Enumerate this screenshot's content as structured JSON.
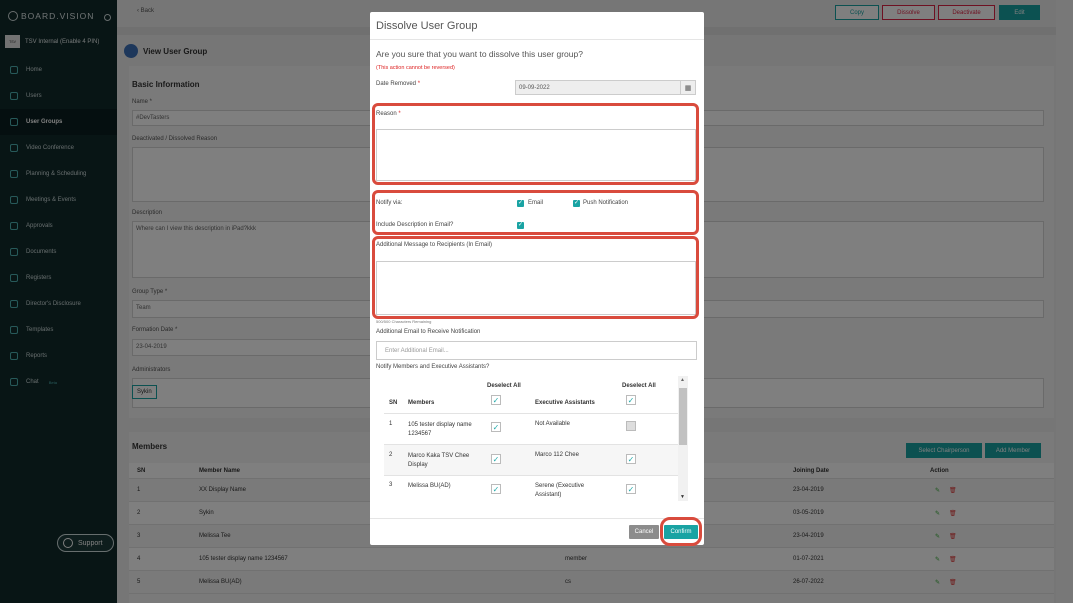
{
  "app": {
    "logo_text": "BOARD.VISION",
    "org_badge": "TSV",
    "org_name": "TSV Internal (Enable 4 PIN)"
  },
  "sidebar": {
    "items": [
      {
        "label": "Home",
        "icon": "home-icon"
      },
      {
        "label": "Users",
        "icon": "user-icon"
      },
      {
        "label": "User Groups",
        "icon": "users-icon",
        "active": true
      },
      {
        "label": "Video Conference",
        "icon": "video-icon"
      },
      {
        "label": "Planning & Scheduling",
        "icon": "chart-icon"
      },
      {
        "label": "Meetings & Events",
        "icon": "calendar-icon"
      },
      {
        "label": "Approvals",
        "icon": "approval-icon"
      },
      {
        "label": "Documents",
        "icon": "document-icon"
      },
      {
        "label": "Registers",
        "icon": "register-icon"
      },
      {
        "label": "Director's Disclosure",
        "icon": "disclosure-icon"
      },
      {
        "label": "Templates",
        "icon": "template-icon"
      },
      {
        "label": "Reports",
        "icon": "report-icon"
      },
      {
        "label": "Chat",
        "icon": "chat-icon",
        "badge": "Beta"
      }
    ],
    "support": "Support"
  },
  "page": {
    "back": "‹ Back",
    "buttons": {
      "copy": "Copy",
      "dissolve": "Dissolve",
      "deactivate": "Deactivate",
      "edit": "Edit"
    },
    "title": "View User Group",
    "basic": {
      "heading": "Basic Information",
      "name_label": "Name *",
      "name_value": "#DevTasters",
      "reason_label": "Deactivated / Dissolved Reason",
      "description_label": "Description",
      "description_value": "Where can I view this description in iPad?kkk",
      "group_type_label": "Group Type *",
      "group_type_value": "Team",
      "formation_label": "Formation Date *",
      "formation_value": "23-04-2019",
      "admins_label": "Administrators",
      "admin_chip": "Sykin"
    },
    "members": {
      "heading": "Members",
      "select_chair": "Select Chairperson",
      "add_member": "Add Member",
      "headers": {
        "sn": "SN",
        "name": "Member Name",
        "joining": "Joining Date",
        "action": "Action"
      },
      "rows": [
        {
          "sn": "1",
          "name": "XX Display Name",
          "role": "",
          "date": "23-04-2019"
        },
        {
          "sn": "2",
          "name": "Sykin",
          "role": "",
          "date": "03-05-2019"
        },
        {
          "sn": "3",
          "name": "Melissa Tee",
          "role": "",
          "date": "23-04-2019"
        },
        {
          "sn": "4",
          "name": "105 tester display name 1234567",
          "role": "member",
          "date": "01-07-2021"
        },
        {
          "sn": "5",
          "name": "Melissa BU(AD)",
          "role": "cs",
          "date": "26-07-2022"
        }
      ]
    }
  },
  "modal": {
    "title": "Dissolve User Group",
    "question": "Are you sure that you want to dissolve this user group?",
    "warning": "(This action cannot be reversed)",
    "date_label": "Date Removed",
    "date_value": "09-09-2022",
    "reason_label": "Reason",
    "notify_label": "Notify via:",
    "email_label": "Email",
    "push_label": "Push Notification",
    "include_desc_label": "Include Description in Email?",
    "additional_msg_label": "Additional Message to Recipients (In Email)",
    "remaining": "500/500 Characters Remaining",
    "additional_email_label": "Additional Email to Receive Notification",
    "additional_email_placeholder": "Enter Additional Email...",
    "notify_members_label": "Notify Members and Executive Assistants?",
    "table": {
      "deselect_all": "Deselect All",
      "sn": "SN",
      "members": "Members",
      "assistants": "Executive Assistants",
      "rows": [
        {
          "sn": "1",
          "member": "105 tester display name 1234567",
          "assistant": "Not Available",
          "member_checked": true,
          "assistant_checked": false
        },
        {
          "sn": "2",
          "member": "Marco Kaka TSV Chee Display",
          "assistant": "Marco 112 Chee",
          "member_checked": true,
          "assistant_checked": true
        },
        {
          "sn": "3",
          "member": "Melissa BU(AD)",
          "assistant": "Serene (Executive Assistant)",
          "member_checked": true,
          "assistant_checked": true
        }
      ]
    },
    "cancel": "Cancel",
    "confirm": "Confirm",
    "highlight_color": "#d94b3d"
  }
}
